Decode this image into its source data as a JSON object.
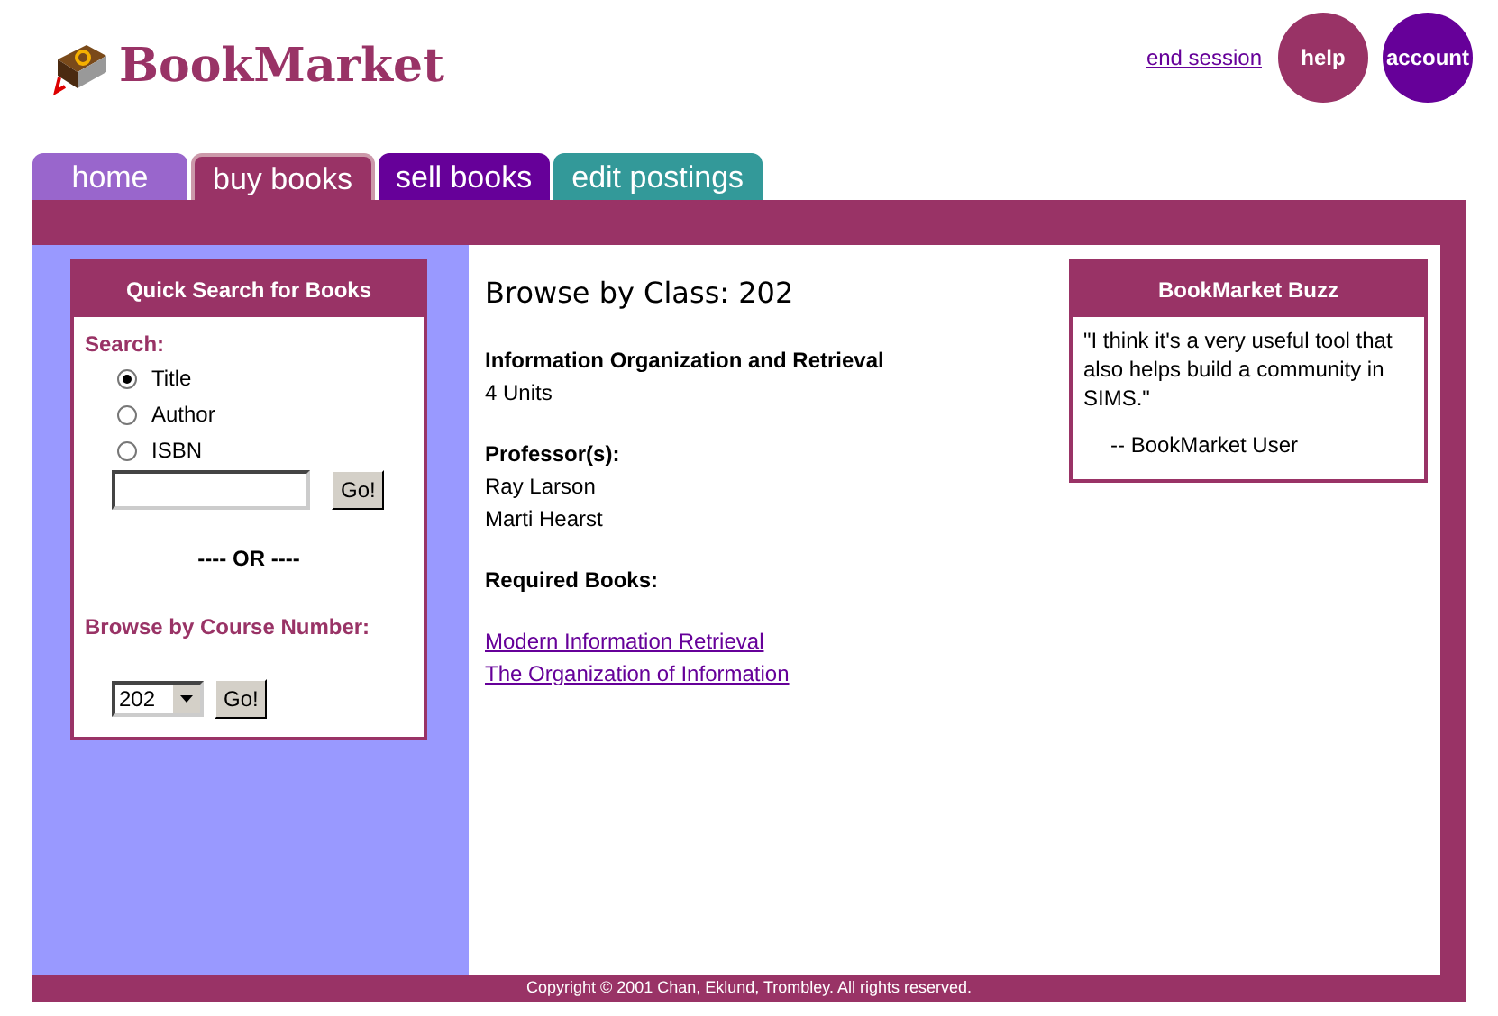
{
  "header": {
    "logo": "BookMarket",
    "end_session": "end session",
    "buttons": [
      {
        "label": "help",
        "color": "#993366"
      },
      {
        "label": "account",
        "color": "#660099"
      }
    ]
  },
  "tabs": [
    {
      "label": "home",
      "color": "#9966cc",
      "selected": false
    },
    {
      "label": "buy books",
      "color": "#993366",
      "selected": true
    },
    {
      "label": "sell books",
      "color": "#660099",
      "selected": false
    },
    {
      "label": "edit postings",
      "color": "#339999",
      "selected": false
    }
  ],
  "quick_search": {
    "title": "Quick Search for Books",
    "search_label": "Search:",
    "options": [
      {
        "label": "Title",
        "selected": true
      },
      {
        "label": "Author",
        "selected": false
      },
      {
        "label": "ISBN",
        "selected": false
      }
    ],
    "go": "Go!",
    "or": "---- OR ----",
    "browse_label": "Browse by Course Number:",
    "course": "202",
    "go2": "Go!"
  },
  "content": {
    "heading": "Browse by Class: 202",
    "course_title": "Information Organization and Retrieval",
    "units": "4 Units",
    "professors_label": "Professor(s):",
    "professors": [
      "Ray Larson",
      "Marti Hearst"
    ],
    "books_label": "Required Books:",
    "books": [
      "Modern Information Retrieval",
      "The Organization of Information"
    ]
  },
  "buzz": {
    "title": "BookMarket Buzz",
    "quote": "\"I think it's a very useful tool that also helps build a community in SIMS.\"",
    "attribution": "-- BookMarket User"
  },
  "footer": "Copyright © 2001 Chan, Eklund, Trombley. All rights reserved."
}
